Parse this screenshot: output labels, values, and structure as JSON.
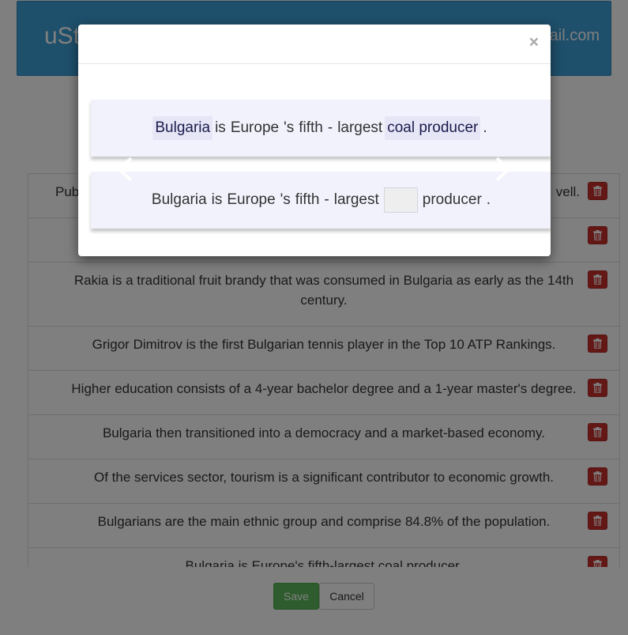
{
  "header": {
    "brand": "uSt",
    "email": "ail.com"
  },
  "list": {
    "rows": [
      {
        "text": "Pub                                                                                                        vell.",
        "partial": true
      },
      {
        "text": ""
      },
      {
        "text": "Rakia is a traditional fruit brandy that was consumed in Bulgaria as early as the 14th century."
      },
      {
        "text": "Grigor Dimitrov is the first Bulgarian tennis player in the Top 10 ATP Rankings."
      },
      {
        "text": "Higher education consists of a 4-year bachelor degree and a 1-year master's degree."
      },
      {
        "text": "Bulgaria then transitioned into a democracy and a market-based economy."
      },
      {
        "text": "Of the services sector, tourism is a significant contributor to economic growth."
      },
      {
        "text": "Bulgarians are the main ethnic group and comprise 84.8% of the population."
      },
      {
        "text": "Bulgaria is Europe's fifth-largest coal producer."
      }
    ]
  },
  "footer": {
    "save_label": "Save",
    "cancel_label": "Cancel"
  },
  "modal": {
    "close_glyph": "×",
    "card1": {
      "tokens": [
        "Bulgaria",
        "is",
        "Europe",
        "'s",
        "fifth",
        "-",
        "largest",
        "coal producer",
        "."
      ],
      "highlighted": [
        0,
        7
      ]
    },
    "card2": {
      "before": [
        "Bulgaria",
        "is",
        "Europe",
        "'s",
        "fifth",
        "-",
        "largest"
      ],
      "after": [
        "producer",
        "."
      ]
    },
    "prev_icon": "chevron-left-icon",
    "next_icon": "chevron-right-icon"
  },
  "colors": {
    "header_bg": "#3c9fd7",
    "save_bg": "#5cb85c",
    "delete_bg": "#c9302c",
    "card_bg": "#f2f2fd"
  }
}
